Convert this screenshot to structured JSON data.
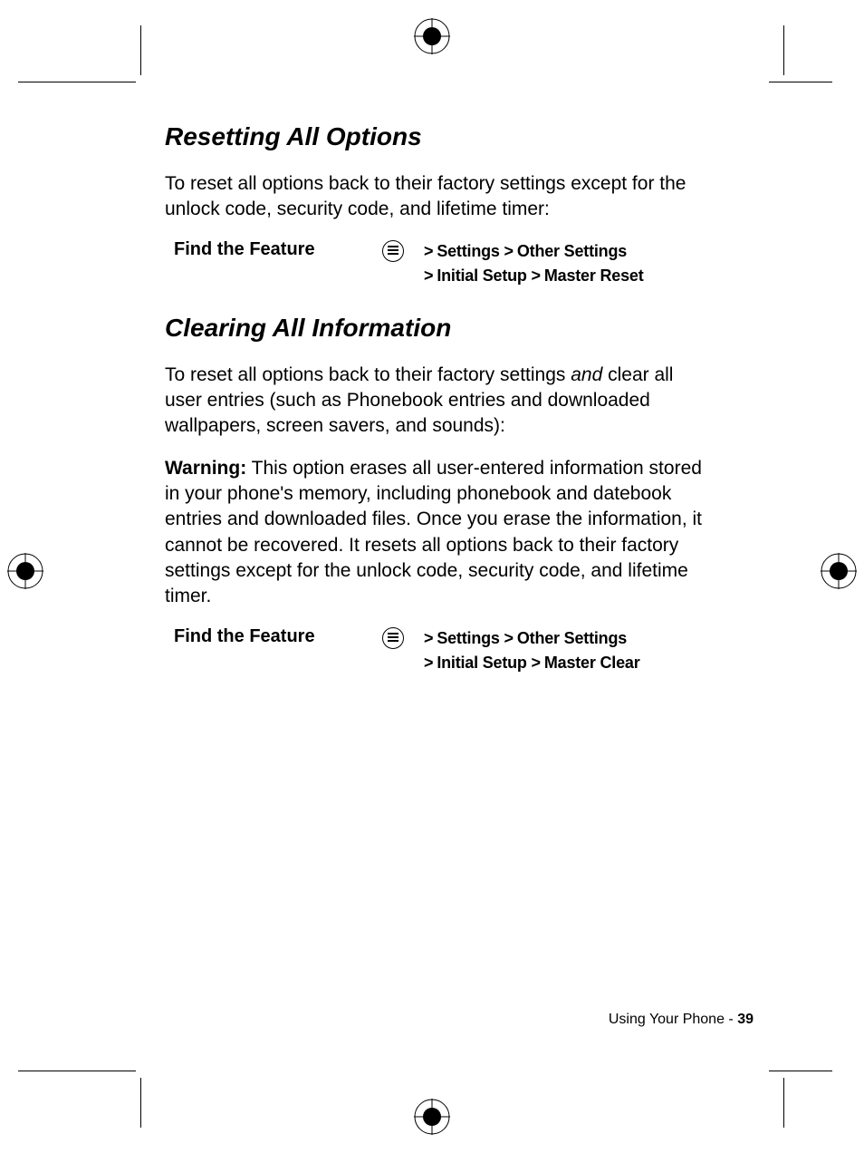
{
  "section1": {
    "heading": "Resetting All Options",
    "body": "To reset all options back to their factory settings except for the unlock code, security code, and lifetime timer:",
    "feature_label": "Find the Feature",
    "path_line1_a": "Settings",
    "path_line1_b": "Other Settings",
    "path_line2_a": "Initial Setup",
    "path_line2_b": "Master Reset"
  },
  "section2": {
    "heading": "Clearing All Information",
    "body_pre": "To reset all options back to their factory settings ",
    "body_and": "and",
    "body_post": " clear all user entries (such as Phonebook entries and downloaded wallpapers, screen savers, and sounds):",
    "warning_label": "Warning:",
    "warning_body": " This option erases all user-entered information stored in your phone's memory, including phonebook and datebook entries and downloaded files. Once you erase the information, it cannot be recovered. It resets all options back to their factory settings except for the unlock code, security code, and lifetime timer.",
    "feature_label": "Find the Feature",
    "path_line1_a": "Settings",
    "path_line1_b": "Other Settings",
    "path_line2_a": "Initial Setup",
    "path_line2_b": "Master Clear"
  },
  "footer": {
    "text": "Using Your Phone - ",
    "page": "39"
  }
}
